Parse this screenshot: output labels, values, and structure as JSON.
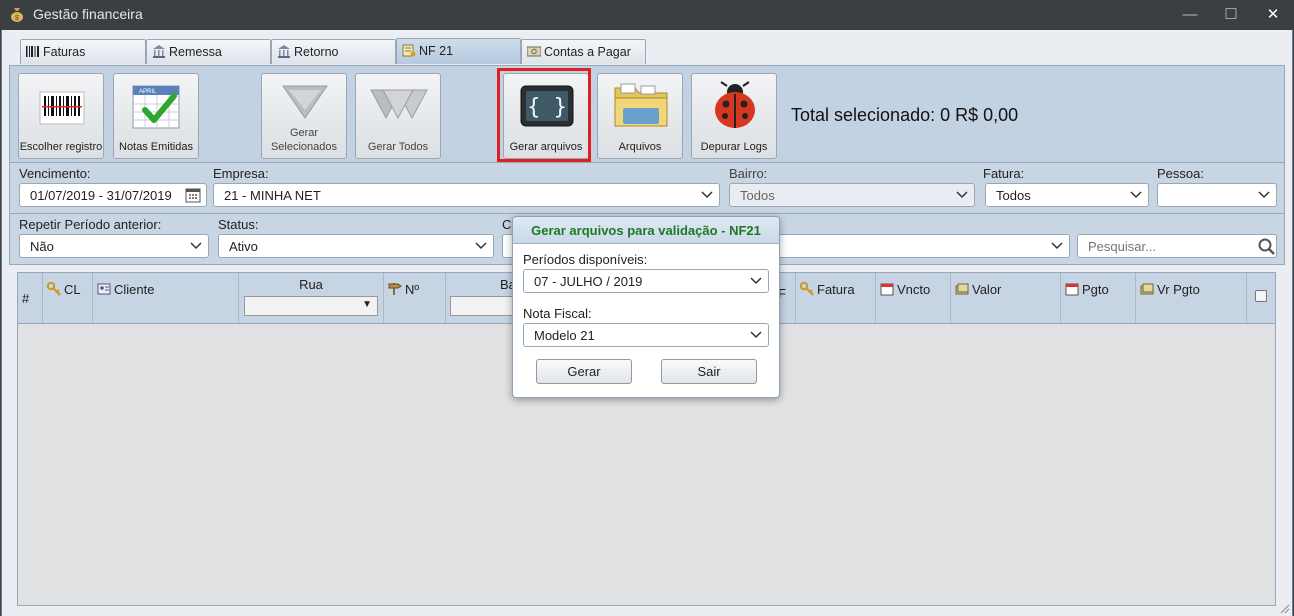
{
  "window": {
    "title": "Gestão financeira",
    "controls": {
      "minimize": "—",
      "maximize": "☐",
      "close": "✕"
    }
  },
  "tabs": [
    {
      "label": "Faturas",
      "icon": "barcode-icon",
      "active": false
    },
    {
      "label": "Remessa",
      "icon": "bank-icon",
      "active": false
    },
    {
      "label": "Retorno",
      "icon": "bank-icon",
      "active": false
    },
    {
      "label": "NF 21",
      "icon": "invoice-icon",
      "active": true
    },
    {
      "label": "Contas a Pagar",
      "icon": "bill-icon",
      "active": false
    }
  ],
  "toolbar": {
    "buttons": [
      {
        "label": "Escolher registro",
        "icon": "barcode-scanner-icon",
        "enabled": true
      },
      {
        "label": "Notas Emitidas",
        "icon": "calendar-check-icon",
        "enabled": true,
        "calendar_text": "APRIL"
      },
      {
        "label": "Gerar Selecionados",
        "icon": "funnel-down-icon",
        "enabled": false
      },
      {
        "label": "Gerar Todos",
        "icon": "double-funnel-icon",
        "enabled": false
      },
      {
        "label": "Gerar arquivos",
        "icon": "code-braces-icon",
        "enabled": true,
        "highlighted": true
      },
      {
        "label": "Arquivos",
        "icon": "folder-icon",
        "enabled": true
      },
      {
        "label": "Depurar Logs",
        "icon": "ladybug-icon",
        "enabled": true
      }
    ],
    "total_label": "Total selecionado: 0 R$ 0,00"
  },
  "filters": {
    "vencimento": {
      "label": "Vencimento:",
      "value": "01/07/2019 - 31/07/2019"
    },
    "empresa": {
      "label": "Empresa:",
      "value": "21 - MINHA NET"
    },
    "bairro": {
      "label": "Bairro:",
      "value": "Todos"
    },
    "fatura": {
      "label": "Fatura:",
      "value": "Todos"
    },
    "pessoa": {
      "label": "Pessoa:",
      "value": ""
    },
    "repetir": {
      "label": "Repetir Período anterior:",
      "value": "Não"
    },
    "status": {
      "label": "Status:",
      "value": "Ativo"
    },
    "co": {
      "label": "Co",
      "value": ""
    },
    "search": {
      "placeholder": "Pesquisar..."
    }
  },
  "grid": {
    "columns": [
      "#",
      "CL",
      "Cliente",
      "Rua",
      "Nº",
      "Ba",
      "F",
      "Fatura",
      "Vncto",
      "Valor",
      "Pgto",
      "Vr Pgto"
    ],
    "rows": []
  },
  "modal": {
    "title": "Gerar arquivos para validação - NF21",
    "period_label": "Períodos disponíveis:",
    "period_value": "07 - JULHO / 2019",
    "nota_label": "Nota Fiscal:",
    "nota_value": "Modelo 21",
    "generate_label": "Gerar",
    "exit_label": "Sair"
  },
  "colors": {
    "titlebar": "#3b3f42",
    "toolbar_bg": "#c3d2e2",
    "highlight": "#e02020",
    "modal_title": "#1d7a21"
  }
}
